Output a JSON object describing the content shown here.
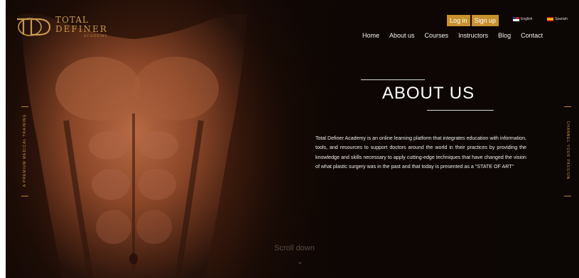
{
  "brand": {
    "line1": "TOTAL",
    "line2": "DEFINER",
    "line3": "ACADEMY",
    "color": "#c99a4a"
  },
  "auth": {
    "login_label": "Log in",
    "signup_label": "Sign up",
    "button_color": "#c8912f"
  },
  "languages": [
    {
      "label": "English",
      "icon": "us-flag-icon"
    },
    {
      "label": "Spanish",
      "icon": "spain-flag-icon"
    }
  ],
  "nav": {
    "items": [
      {
        "label": "Home"
      },
      {
        "label": "About us"
      },
      {
        "label": "Courses"
      },
      {
        "label": "Instructors"
      },
      {
        "label": "Blog"
      },
      {
        "label": "Contact"
      }
    ]
  },
  "hero": {
    "title": "ABOUT US",
    "paragraph": "Total Definer Academy is an online learning platform that integrates education with information, tools, and resources to support doctors around the world in their practices by providing the knowledge and skills necessary to apply cutting-edge techniques that have changed the vision of what plastic surgery was in the past and that today is presented as a \"STATE OF ART\"",
    "left_vertical": "A PREMIUM MEDICAL TRAINING",
    "right_vertical": "CHANNEL YOUR PASSION",
    "scroll_label": "Scroll down"
  }
}
